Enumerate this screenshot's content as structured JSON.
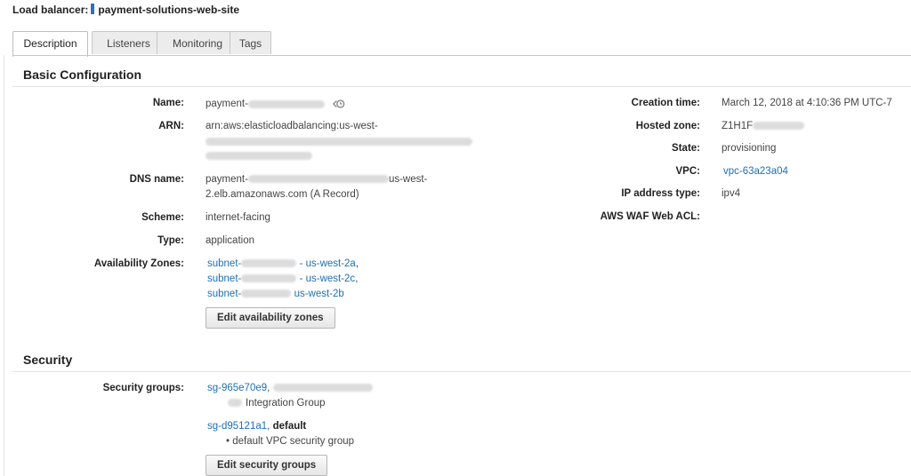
{
  "header": {
    "label": "Load balancer:",
    "name": "payment-solutions-web-site"
  },
  "tabs": [
    {
      "label": "Description",
      "active": true
    },
    {
      "label": "Listeners",
      "active": false
    },
    {
      "label": "Monitoring",
      "active": false
    },
    {
      "label": "Tags",
      "active": false
    }
  ],
  "basic": {
    "title": "Basic Configuration",
    "left": {
      "name": {
        "key": "Name:",
        "value": "payment-"
      },
      "arn": {
        "key": "ARN:",
        "value": "arn:aws:elasticloadbalancing:us-west-"
      },
      "dns": {
        "key": "DNS name:",
        "value_prefix": "payment-",
        "value_mid": "us-west-",
        "value_line2": "2.elb.amazonaws.com (A Record)"
      },
      "scheme": {
        "key": "Scheme:",
        "value": "internet-facing"
      },
      "type": {
        "key": "Type:",
        "value": "application"
      },
      "az": {
        "key": "Availability Zones:",
        "items": [
          {
            "prefix": "subnet-",
            "zone": "- us-west-2a",
            "sep": ","
          },
          {
            "prefix": "subnet-",
            "zone": "- us-west-2c",
            "sep": ","
          },
          {
            "prefix": "subnet-",
            "zone": "us-west-2b",
            "sep": ""
          }
        ],
        "button": "Edit availability zones"
      }
    },
    "right": {
      "creation": {
        "key": "Creation time:",
        "value": "March 12, 2018 at 4:10:36 PM UTC-7"
      },
      "zone": {
        "key": "Hosted zone:",
        "value": "Z1H1F"
      },
      "state": {
        "key": "State:",
        "value": "provisioning"
      },
      "vpc": {
        "key": "VPC:",
        "value": "vpc-63a23a04"
      },
      "ipt": {
        "key": "IP address type:",
        "value": "ipv4"
      },
      "waf": {
        "key": "AWS WAF Web ACL:",
        "value": ""
      }
    }
  },
  "security": {
    "title": "Security",
    "key": "Security groups:",
    "groups": [
      {
        "id": "sg-965e70e9",
        "sep": ",",
        "name": "",
        "desc": "Integration Group"
      },
      {
        "id": "sg-d95121a1",
        "sep": ",",
        "name": "default",
        "desc": "• default VPC security group"
      }
    ],
    "button": "Edit security groups"
  }
}
